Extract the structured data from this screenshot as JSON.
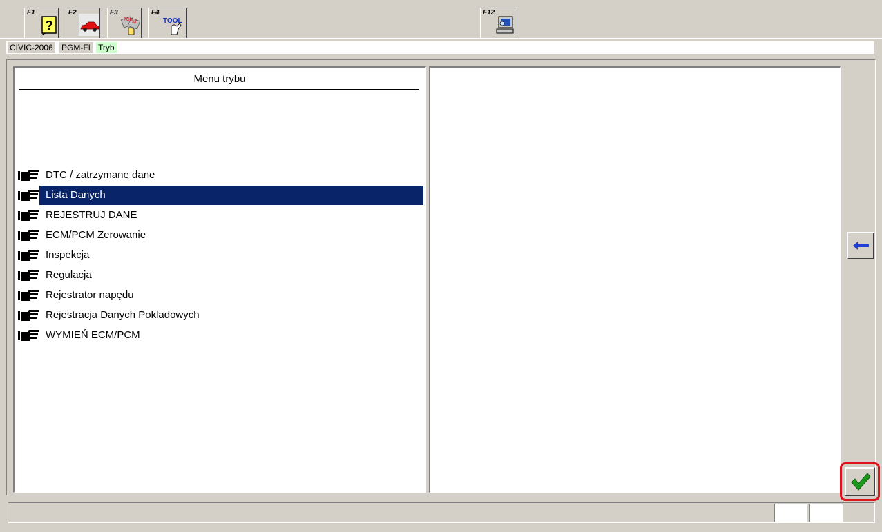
{
  "toolbar": {
    "keys": [
      {
        "label": "F1",
        "icon": "help-icon"
      },
      {
        "label": "F2",
        "icon": "car-icon"
      },
      {
        "label": "F3",
        "icon": "pgm-at-icon"
      },
      {
        "label": "F4",
        "icon": "tool-icon"
      },
      {
        "label": "F12",
        "icon": "computer-icon"
      }
    ]
  },
  "breadcrumb": {
    "items": [
      "CIVIC-2006",
      "PGM-FI",
      "Tryb"
    ],
    "colors": [
      "#d4d0c8",
      "#d4d0c8",
      "#ccffcc"
    ]
  },
  "menu": {
    "title": "Menu trybu",
    "items": [
      "DTC / zatrzymane dane",
      "Lista Danych",
      "REJESTRUJ DANE",
      "ECM/PCM Zerowanie",
      "Inspekcja",
      "Regulacja",
      "Rejestrator napędu",
      "Rejestracja Danych Pokladowych",
      "WYMIEŃ ECM/PCM"
    ],
    "selected_index": 1
  },
  "buttons": {
    "back": "arrow-left-icon",
    "ok": "checkmark-icon"
  },
  "colors": {
    "background": "#d4d0c8",
    "selection": "#0a246a",
    "highlight_ring": "#e0121c",
    "ok_check": "#1a9a1a",
    "back_arrow": "#1f3fd6"
  }
}
